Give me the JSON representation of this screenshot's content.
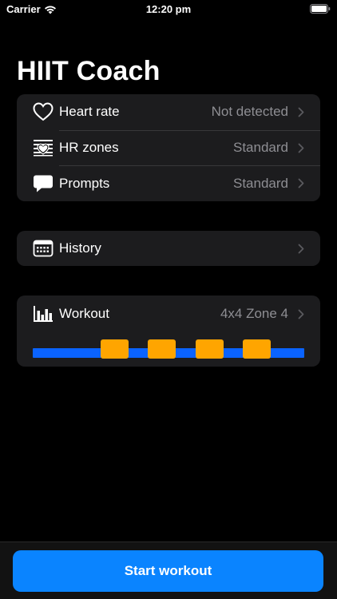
{
  "status_bar": {
    "carrier": "Carrier",
    "time": "12:20 pm",
    "wifi_icon": "wifi-icon",
    "battery_icon": "battery-icon"
  },
  "title": "HIIT Coach",
  "settings": [
    {
      "icon": "heart-icon",
      "label": "Heart rate",
      "value": "Not detected"
    },
    {
      "icon": "hr-zones-icon",
      "label": "HR zones",
      "value": "Standard"
    },
    {
      "icon": "speech-bubble-icon",
      "label": "Prompts",
      "value": "Standard"
    }
  ],
  "history": {
    "icon": "calendar-icon",
    "label": "History"
  },
  "workout": {
    "icon": "bar-chart-icon",
    "label": "Workout",
    "value": "4x4 Zone 4",
    "intervals": 4
  },
  "start_button": "Start workout",
  "colors": {
    "background": "#000000",
    "card": "#1c1c1e",
    "secondary_text": "#8e8e93",
    "accent_blue": "#0a84ff",
    "workout_base": "#0a63ff",
    "interval_orange": "#ffa500"
  }
}
